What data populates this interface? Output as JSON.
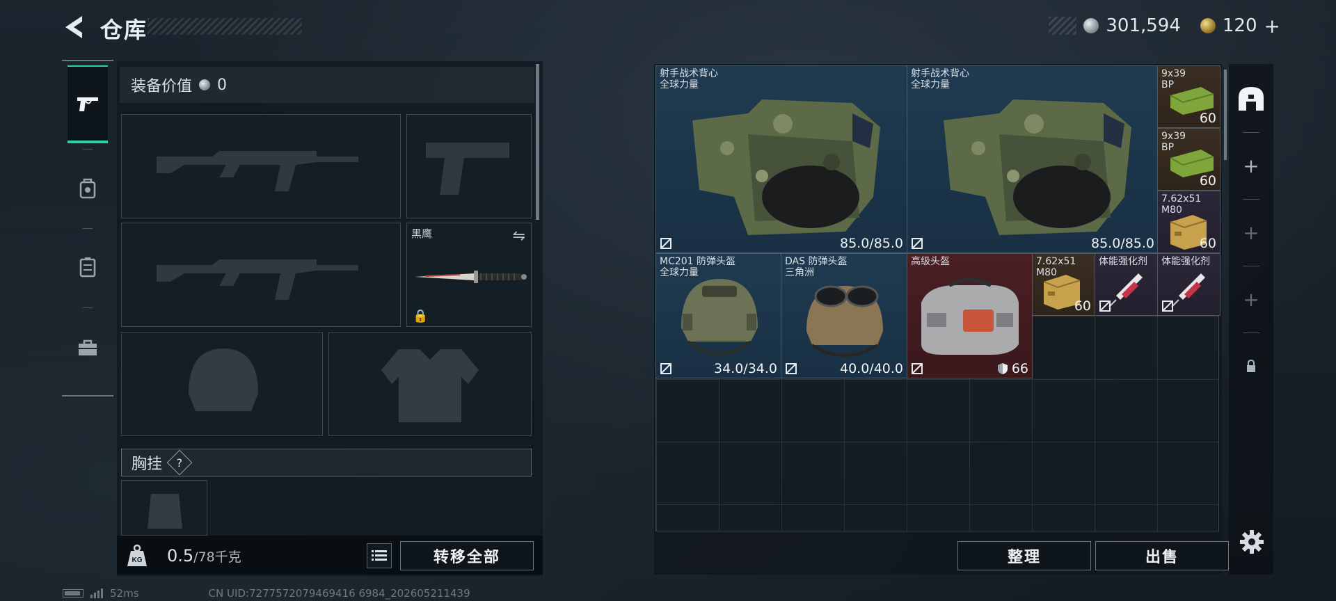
{
  "header": {
    "title": "仓库",
    "currency_main": "301,594",
    "currency_premium": "120",
    "premium_plus": "+"
  },
  "tabs": [
    {
      "icon": "pistol-icon",
      "active": true
    },
    {
      "icon": "helmet-icon",
      "active": false
    },
    {
      "icon": "vest-icon",
      "active": false
    },
    {
      "icon": "toolbox-icon",
      "active": false
    }
  ],
  "loadout": {
    "equip_value_label": "装备价值",
    "equip_value": "0",
    "melee_name": "黑鹰",
    "chest_rig_label": "胸挂",
    "chest_help": "?",
    "weight_current": "0.5",
    "weight_max": "/78千克",
    "transfer_all": "转移全部"
  },
  "stash": {
    "items": [
      {
        "id": "vest1",
        "name1": "射手战术背心",
        "name2": "全球力量",
        "value": "85.0/85.0"
      },
      {
        "id": "vest2",
        "name1": "射手战术背心",
        "name2": "全球力量",
        "value": "85.0/85.0"
      },
      {
        "id": "ammo1",
        "name1": "9x39",
        "name2": "BP",
        "count": "60"
      },
      {
        "id": "ammo2",
        "name1": "9x39",
        "name2": "BP",
        "count": "60"
      },
      {
        "id": "ammo3",
        "name1": "7.62x51",
        "name2": "M80",
        "count": "60"
      },
      {
        "id": "helm1",
        "name1": "MC201 防弹头盔",
        "name2": "全球力量",
        "value": "34.0/34.0"
      },
      {
        "id": "helm2",
        "name1": "DAS 防弹头盔",
        "name2": "三角洲",
        "value": "40.0/40.0"
      },
      {
        "id": "case1",
        "name1": "高级头盔",
        "value": "66"
      },
      {
        "id": "ammo4",
        "name1": "7.62x51",
        "name2": "M80",
        "count": "60"
      },
      {
        "id": "stim1",
        "name1": "体能强化剂"
      },
      {
        "id": "stim2",
        "name1": "体能强化剂"
      }
    ],
    "sort_label": "整理",
    "sell_label": "出售"
  },
  "status": {
    "ping": "52ms",
    "uid": "CN UID:7277572079469416 6984_202605211439"
  },
  "colors": {
    "accent": "#2ad3a5",
    "item_blue": "#1f3a50",
    "item_red": "#4a1f24",
    "item_brown": "#3b2e22"
  }
}
